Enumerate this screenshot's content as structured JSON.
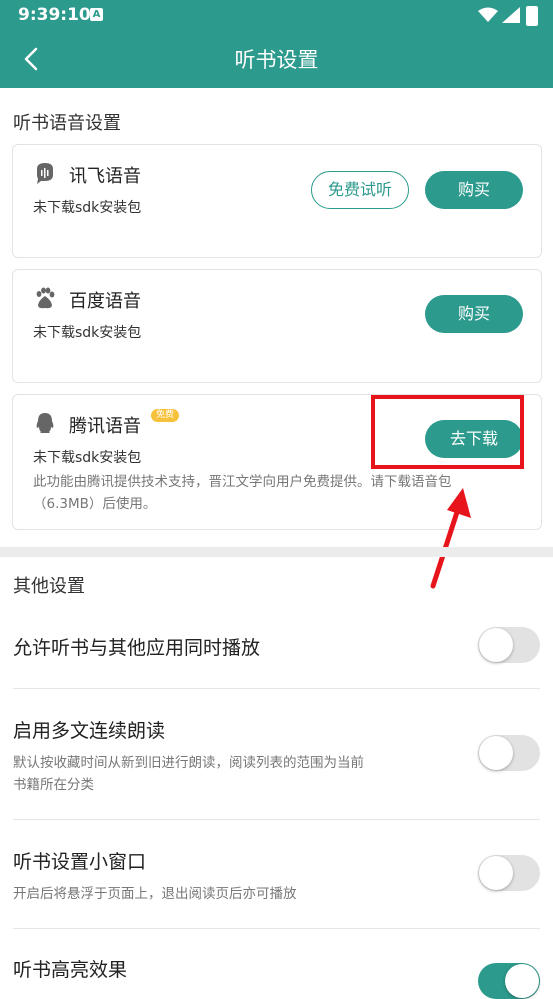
{
  "status_bar": {
    "time": "9:39:10",
    "notif_letter": "A"
  },
  "app_bar": {
    "title": "听书设置"
  },
  "voice_section": {
    "title": "听书语音设置",
    "cards": [
      {
        "name": "讯飞语音",
        "status": "未下载sdk安装包",
        "trial_label": "免费试听",
        "action_label": "购买"
      },
      {
        "name": "百度语音",
        "status": "未下载sdk安装包",
        "action_label": "购买"
      },
      {
        "name": "腾讯语音",
        "badge": "免费",
        "status": "未下载sdk安装包",
        "action_label": "去下载",
        "description": "此功能由腾讯提供技术支持，晋江文学向用户免费提供。请下载语音包（6.3MB）后使用。"
      }
    ]
  },
  "other_section": {
    "title": "其他设置",
    "rows": [
      {
        "title": "允许听书与其他应用同时播放",
        "enabled": false
      },
      {
        "title": "启用多文连续朗读",
        "description": "默认按收藏时间从新到旧进行朗读，阅读列表的范围为当前书籍所在分类",
        "enabled": false
      },
      {
        "title": "听书设置小窗口",
        "description": "开启后将悬浮于页面上，退出阅读页后亦可播放",
        "enabled": false
      },
      {
        "title": "听书高亮效果",
        "enabled": true
      }
    ]
  },
  "colors": {
    "accent": "#2c9a8c",
    "annotation": "#e8141c"
  }
}
